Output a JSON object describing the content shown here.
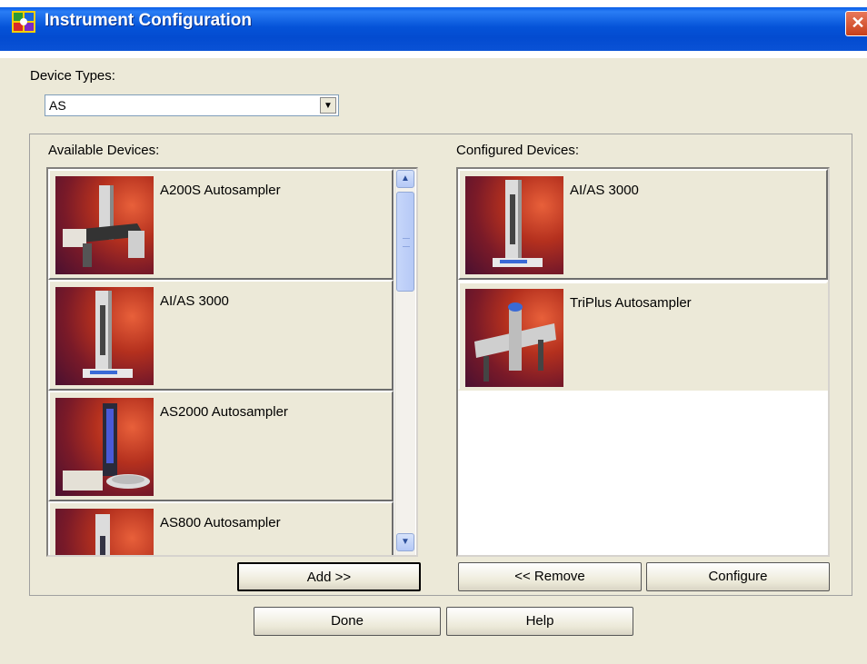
{
  "window": {
    "title": "Instrument Configuration",
    "close_glyph": "✕"
  },
  "device_types": {
    "label": "Device Types:",
    "selected": "AS"
  },
  "available": {
    "label": "Available Devices:",
    "items": [
      {
        "name": "A200S Autosampler",
        "image": "a200s-autosampler-image"
      },
      {
        "name": "AI/AS 3000",
        "image": "aias-3000-image"
      },
      {
        "name": "AS2000 Autosampler",
        "image": "as2000-autosampler-image"
      },
      {
        "name": "AS800 Autosampler",
        "image": "as800-autosampler-image"
      }
    ]
  },
  "configured": {
    "label": "Configured Devices:",
    "items": [
      {
        "name": "AI/AS 3000",
        "image": "aias-3000-image"
      },
      {
        "name": "TriPlus Autosampler",
        "image": "triplus-autosampler-image"
      }
    ]
  },
  "buttons": {
    "add": "Add >>",
    "remove": "<< Remove",
    "configure": "Configure",
    "done": "Done",
    "help": "Help"
  },
  "colors": {
    "title_bar": "#0553d8",
    "dialog_bg": "#ece9d8",
    "close": "#c8401a"
  }
}
